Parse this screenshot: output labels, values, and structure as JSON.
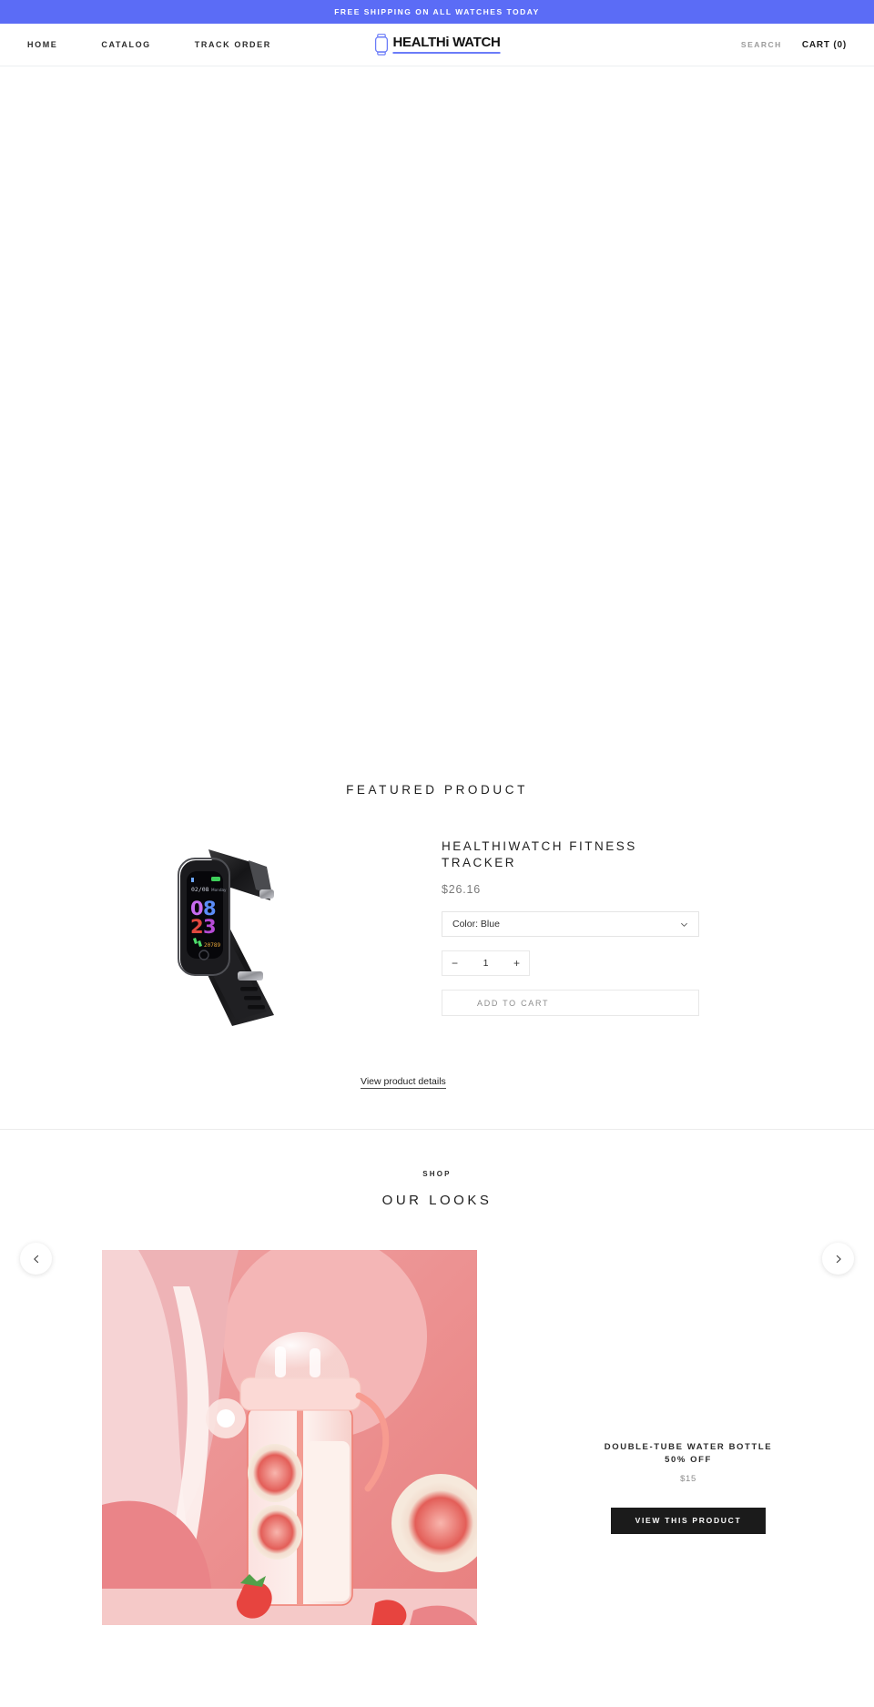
{
  "announcement": {
    "text": "FREE SHIPPING ON ALL WATCHES TODAY",
    "bg_color": "#5b6cf6"
  },
  "header": {
    "nav": [
      {
        "label": "HOME"
      },
      {
        "label": "CATALOG"
      },
      {
        "label": "TRACK ORDER"
      }
    ],
    "logo": {
      "text": "HEALTHi WATCH",
      "icon": "watch-icon",
      "accent_color": "#6b7cf8"
    },
    "search_label": "SEARCH",
    "cart_label": "CART (0)",
    "cart_count": 0
  },
  "featured": {
    "section_title": "FEATURED PRODUCT",
    "product_name": "HEALTHIWATCH FITNESS TRACKER",
    "price": "$26.16",
    "variant_label": "Color: Blue",
    "variant_options": [
      "Color: Blue"
    ],
    "quantity": "1",
    "qty_decrease": "−",
    "qty_increase": "+",
    "add_to_cart_label": "ADD TO CART",
    "details_link_label": "View product details",
    "watch_display": {
      "date": "02/08",
      "weekday": "Monday",
      "hour": "08",
      "minute": "23",
      "steps": "20789"
    }
  },
  "looks": {
    "kicker": "SHOP",
    "title": "OUR LOOKS",
    "slide": {
      "name": "DOUBLE-TUBE WATER BOTTLE 50% OFF",
      "price": "$15",
      "button_label": "VIEW THIS PRODUCT"
    },
    "prev_label": "Previous",
    "next_label": "Next"
  }
}
